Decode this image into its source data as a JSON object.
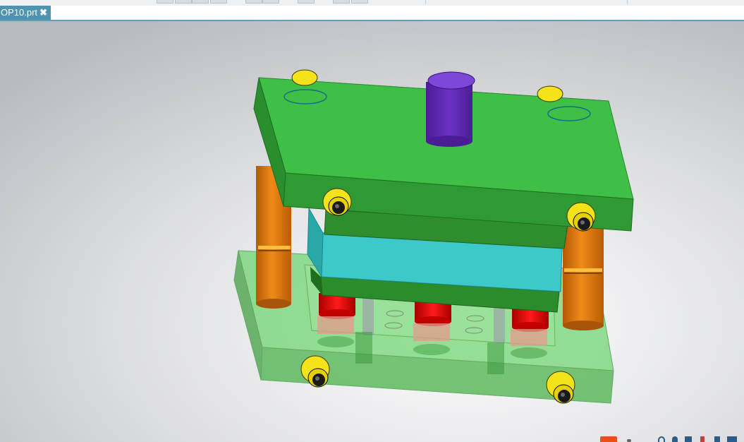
{
  "document_tabs": [
    {
      "label": "OP10.prt",
      "close_glyph": "✖",
      "active": true
    }
  ],
  "viewport": {
    "model": "stamping-die-assembly",
    "colors": {
      "upper_plate": "#3fbf45",
      "die_plate": "#3dc9c9",
      "guide_post": "#e07a10",
      "bushing": "#e6d800",
      "punch_shank": "#6a2fbf",
      "punches": "#e00000",
      "lower_base": "#4cc24c"
    }
  },
  "toolbar": {
    "icons": [
      "tool-icon",
      "tool-icon",
      "tool-icon",
      "tool-icon",
      "tool-icon",
      "tool-icon",
      "tool-icon",
      "tool-icon",
      "tool-icon",
      "tool-icon"
    ]
  },
  "status_tray": {
    "icons": [
      "app-logo-icon",
      "dot-icon",
      "help-icon",
      "user-icon",
      "grid-icon",
      "pen-icon",
      "check-icon",
      "close-icon"
    ]
  }
}
